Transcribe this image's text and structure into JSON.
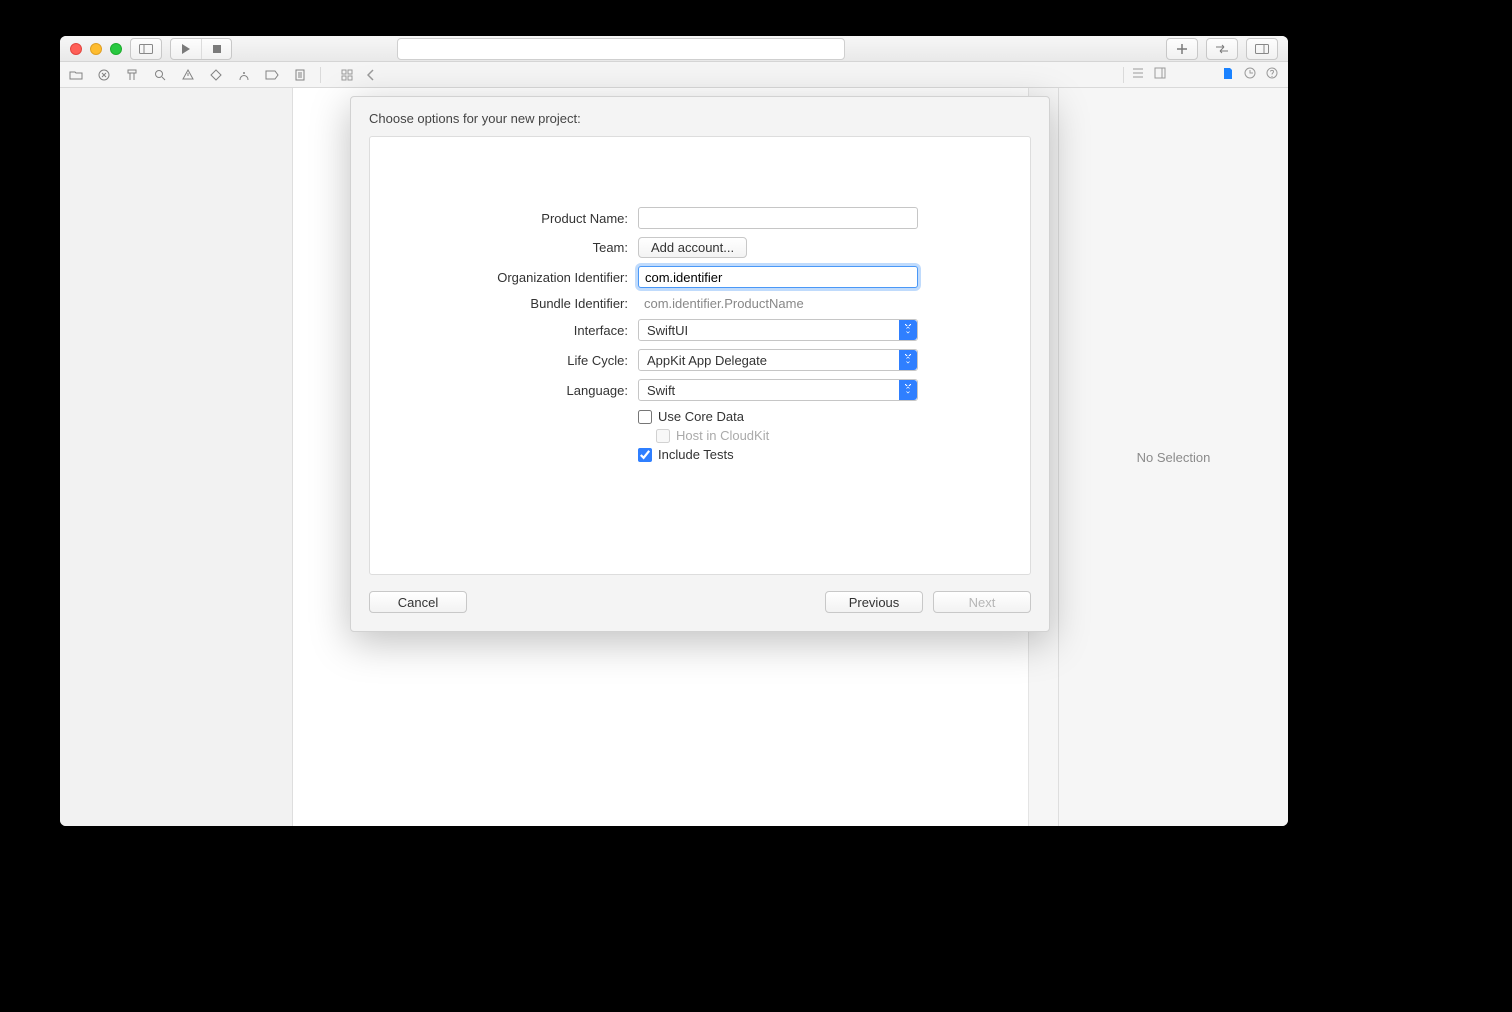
{
  "dialog": {
    "title": "Choose options for your new project:",
    "labels": {
      "product_name": "Product Name:",
      "team": "Team:",
      "org_id": "Organization Identifier:",
      "bundle_id": "Bundle Identifier:",
      "interface": "Interface:",
      "lifecycle": "Life Cycle:",
      "language": "Language:"
    },
    "values": {
      "product_name": "",
      "team_button": "Add account...",
      "org_id": "com.identifier",
      "bundle_id": "com.identifier.ProductName",
      "interface": "SwiftUI",
      "lifecycle": "AppKit App Delegate",
      "language": "Swift"
    },
    "checkboxes": {
      "use_core_data": {
        "label": "Use Core Data",
        "checked": false
      },
      "host_icloudkit": {
        "label": "Host in CloudKit",
        "checked": false,
        "disabled": true
      },
      "include_tests": {
        "label": "Include Tests",
        "checked": true
      }
    },
    "buttons": {
      "cancel": "Cancel",
      "previous": "Previous",
      "next": "Next"
    }
  },
  "right_panel": {
    "no_selection": "No Selection"
  }
}
